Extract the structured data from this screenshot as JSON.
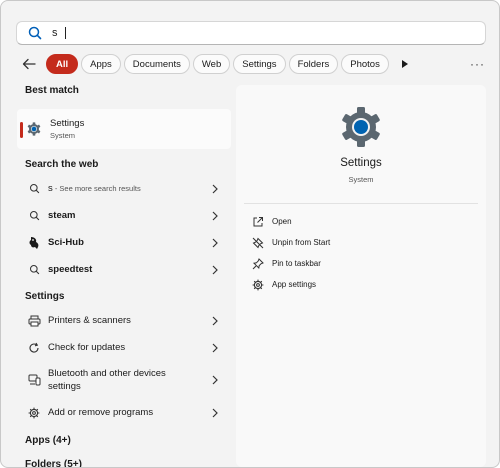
{
  "search": {
    "value": "s"
  },
  "filters": {
    "items": [
      "All",
      "Apps",
      "Documents",
      "Web",
      "Settings",
      "Folders",
      "Photos"
    ],
    "more_label": "···"
  },
  "best_match": {
    "heading": "Best match",
    "title": "Settings",
    "subtitle": "System"
  },
  "web": {
    "heading": "Search the web",
    "items": [
      {
        "main": "s",
        "suffix": " - See more search results",
        "icon": "search-icon"
      },
      {
        "main": "steam",
        "icon": "search-icon"
      },
      {
        "main": "Sci-Hub",
        "icon": "scihub-logo-icon"
      },
      {
        "main": "speedtest",
        "icon": "search-icon"
      }
    ]
  },
  "settings_section": {
    "heading": "Settings",
    "items": [
      {
        "label": "Printers & scanners",
        "icon": "printer-icon"
      },
      {
        "label": "Check for updates",
        "icon": "refresh-icon"
      },
      {
        "label": "Bluetooth and other devices settings",
        "line1": "Bluetooth and other devices",
        "line2": "settings",
        "icon": "bluetooth-devices-icon"
      },
      {
        "label": "Add or remove programs",
        "icon": "gear-small-icon"
      }
    ]
  },
  "apps_heading": "Apps (4+)",
  "folders_heading": "Folders (5+)",
  "preview": {
    "title": "Settings",
    "subtitle": "System",
    "actions": [
      "Open",
      "Unpin from Start",
      "Pin to taskbar",
      "App settings"
    ]
  },
  "colors": {
    "accent": "#c42b1c",
    "gear_blue": "#0063b1",
    "gear_gray": "#5b6770"
  }
}
